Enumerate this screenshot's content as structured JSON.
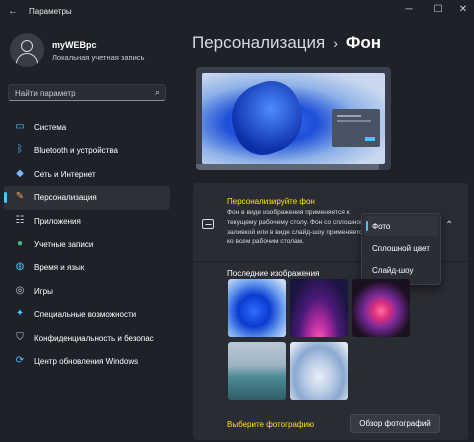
{
  "window": {
    "back_icon": "back-arrow-icon",
    "title": "Параметры",
    "controls": [
      "minimize-icon",
      "maximize-icon",
      "close-icon"
    ]
  },
  "user": {
    "name": "myWEBpc",
    "account_type": "Локальная учетная запись"
  },
  "search": {
    "placeholder": "Найти параметр",
    "icon": "search-icon"
  },
  "sidebar": {
    "items": [
      {
        "label": "Система",
        "icon": "monitor-icon",
        "color": "#4cc2ff"
      },
      {
        "label": "Bluetooth и устройства",
        "icon": "bluetooth-icon",
        "color": "#4cc2ff"
      },
      {
        "label": "Сеть и Интернет",
        "icon": "wifi-icon",
        "color": "#7ab7ff"
      },
      {
        "label": "Персонализация",
        "icon": "brush-icon",
        "color": "#f2a65a",
        "selected": true
      },
      {
        "label": "Приложения",
        "icon": "apps-icon",
        "color": "#c8cad0"
      },
      {
        "label": "Учетные записи",
        "icon": "person-icon",
        "color": "#3fbf7f"
      },
      {
        "label": "Время и язык",
        "icon": "globe-clock-icon",
        "color": "#4cc2ff"
      },
      {
        "label": "Игры",
        "icon": "gamepad-icon",
        "color": "#c8cad0"
      },
      {
        "label": "Специальные возможности",
        "icon": "accessibility-icon",
        "color": "#4cc2ff"
      },
      {
        "label": "Конфиденциальность и безопас",
        "icon": "shield-icon",
        "color": "#c8cad0"
      },
      {
        "label": "Центр обновления Windows",
        "icon": "update-icon",
        "color": "#4cc2ff"
      }
    ]
  },
  "breadcrumb": {
    "parent": "Персонализация",
    "separator": "›",
    "current": "Фон"
  },
  "background_setting": {
    "title": "Персонализируйте фон",
    "description": "Фон в виде изображения применяется к текущему рабочему столу. Фон со сплошной заливкой или в виде слайд-шоу применяется ко всем рабочим столам.",
    "dropdown_options": [
      "Фото",
      "Сплошной цвет",
      "Слайд-шоу"
    ],
    "selected_option": "Фото"
  },
  "recent_images": {
    "label": "Последние изображения",
    "count": 5
  },
  "choose_photo": {
    "label": "Выберите фотографию",
    "button": "Обзор фотографий"
  },
  "colors": {
    "accent": "#4cc2ff",
    "highlight_text": "#ffe600",
    "background": "#1f2129",
    "card": "#2a2c33"
  }
}
